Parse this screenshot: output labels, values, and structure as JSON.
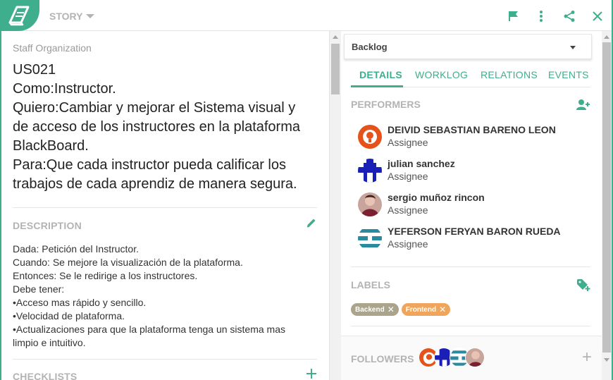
{
  "header": {
    "type_label": "STORY",
    "icons": [
      "book-icon",
      "flag-icon",
      "more-vertical-icon",
      "share-icon",
      "close-icon"
    ]
  },
  "story": {
    "breadcrumb": "Staff Organization",
    "title_lines": [
      "US021",
      "Como:Instructor.",
      "Quiero:Cambiar y mejorar el Sistema visual y",
      "de acceso de los instructores en la plataforma",
      "BlackBoard.",
      "Para:Que cada instructor pueda calificar los",
      "trabajos de cada aprendiz de manera segura."
    ]
  },
  "description": {
    "heading": "DESCRIPTION",
    "lines": [
      "Dada: Petición del Instructor.",
      "Cuando: Se mejore la visualización de la plataforma.",
      "Entonces: Se le redirige a los instructores.",
      "Debe tener:",
      "•Acceso mas rápido y sencillo.",
      "•Velocidad de plataforma.",
      "•Actualizaciones para que la plataforma tenga un sistema mas",
      "limpio e intuitivo."
    ]
  },
  "checklists": {
    "heading": "CHECKLISTS"
  },
  "status": {
    "value": "Backlog"
  },
  "tabs": [
    {
      "label": "DETAILS",
      "active": true
    },
    {
      "label": "WORKLOG",
      "active": false
    },
    {
      "label": "RELATIONS",
      "active": false
    },
    {
      "label": "EVENTS",
      "active": false
    }
  ],
  "performers": {
    "heading": "PERFORMERS",
    "items": [
      {
        "name": "DEIVID SEBASTIAN BARENO LEON",
        "role": "Assignee",
        "avatar": "orange-face"
      },
      {
        "name": "julian sanchez",
        "role": "Assignee",
        "avatar": "blue-pattern"
      },
      {
        "name": "sergio muñoz rincon",
        "role": "Assignee",
        "avatar": "photo"
      },
      {
        "name": "YEFERSON FERYAN BARON RUEDA",
        "role": "Assignee",
        "avatar": "teal-pattern"
      }
    ]
  },
  "labels": {
    "heading": "LABELS",
    "items": [
      {
        "text": "Backend",
        "color": "#a9a48b"
      },
      {
        "text": "Frontend",
        "color": "#efa65c"
      }
    ]
  },
  "followers": {
    "heading": "FOLLOWERS"
  },
  "colors": {
    "accent": "#3fae8d",
    "muted": "#b3b3b3"
  }
}
